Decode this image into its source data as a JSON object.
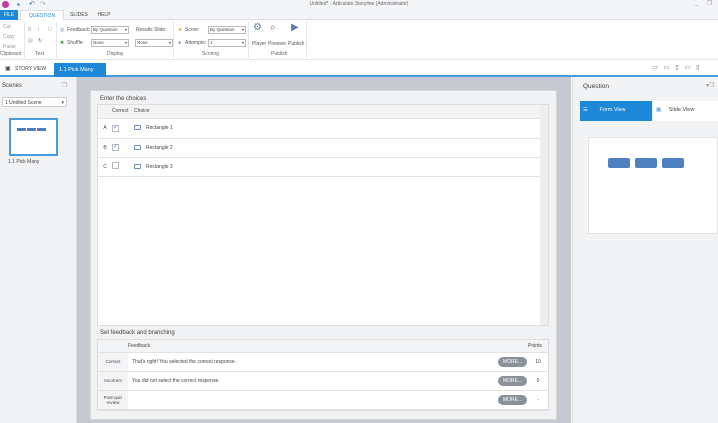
{
  "window": {
    "title": "Untitled* - Articulate Storyline (Administrator)"
  },
  "ribbon": {
    "tabs": [
      "FILE",
      "QUESTION",
      "SLIDES",
      "HELP"
    ],
    "clipboard": {
      "cut": "Cut",
      "copy": "Copy",
      "paste": "Paste",
      "group": "Clipboard"
    },
    "text": {
      "bold": "B",
      "italic": "I",
      "underline": "U",
      "group": "Text"
    },
    "display": {
      "feedback_label": "Feedback:",
      "feedback_value": "By Question",
      "shuffle_label": "Shuffle:",
      "shuffle_value": "None",
      "results_label": "Results Slide:",
      "results_value": "None",
      "group": "Display"
    },
    "scoring": {
      "score_label": "Score:",
      "score_value": "By Question",
      "attempts_label": "Attempts:",
      "attempts_value": "1",
      "group": "Scoring"
    },
    "publish": {
      "player": "Player",
      "preview": "Preview",
      "publish": "Publish",
      "group": "Publish"
    }
  },
  "doc_tabs": {
    "story_view": "STORY VIEW",
    "active": "1.1 Pick Many"
  },
  "scenes": {
    "title": "Scenes",
    "selected": "1 Untitled Scene",
    "slide_label": "1.1 Pick Many"
  },
  "choices": {
    "title": "Enter the choices",
    "col_correct": "Correct",
    "col_choice": "Choice",
    "rows": [
      {
        "letter": "A",
        "checked": true,
        "text": "Rectangle 1"
      },
      {
        "letter": "B",
        "checked": true,
        "text": "Rectangle 2"
      },
      {
        "letter": "C",
        "checked": false,
        "text": "Rectangle 3"
      }
    ]
  },
  "feedback": {
    "title": "Set feedback and branching",
    "col_feedback": "Feedback",
    "col_points": "Points",
    "rows": [
      {
        "label": "Correct",
        "text": "That's right!  You selected the correct response.",
        "more": "MORE...",
        "points": "10"
      },
      {
        "label": "Incorrect",
        "text": "You did not select the correct response.",
        "more": "MORE...",
        "points": "0"
      },
      {
        "label": "Post-quiz review",
        "text": "",
        "more": "MORE...",
        "points": "-"
      }
    ]
  },
  "question_panel": {
    "title": "Question",
    "form_view": "Form View",
    "slide_view": "Slide View"
  },
  "colors": {
    "accent": "#1e88d8",
    "slide_shape": "#4e7fbf"
  }
}
